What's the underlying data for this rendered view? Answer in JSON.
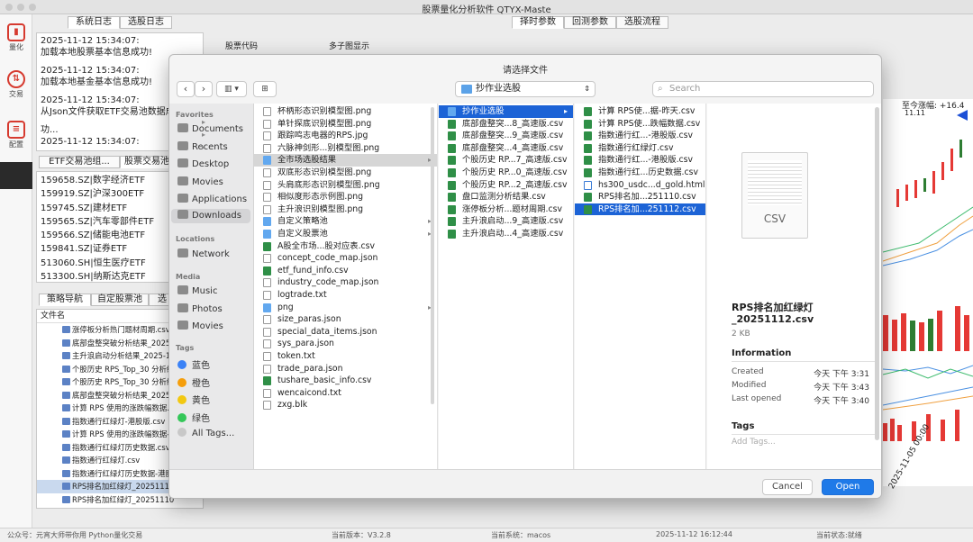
{
  "window": {
    "title": "股票量化分析软件 QTYX-Maste"
  },
  "toolbar": {
    "items": [
      {
        "label": "量化"
      },
      {
        "label": "交易"
      },
      {
        "label": "配置"
      }
    ]
  },
  "left_tabs": [
    "系统日志",
    "选股日志"
  ],
  "log": [
    "2025-11-12 15:34:07:",
    "加载本地股票基本信息成功!",
    "2025-11-12 15:34:07:",
    "加载本地基金基本信息成功!",
    "2025-11-12 15:34:07:",
    "从Json文件获取ETF交易池数据成",
    "功...",
    "2025-11-12 15:34:07:"
  ],
  "etf_tabs": [
    "ETF交易池组...",
    "股票交易池"
  ],
  "etf_list": [
    "159658.SZ|数字经济ETF",
    "159919.SZ|沪深300ETF",
    "159745.SZ|建材ETF",
    "159565.SZ|汽车零部件ETF",
    "159566.SZ|储能电池ETF",
    "159841.SZ|证券ETF",
    "513060.SH|恒生医疗ETF",
    "513300.SH|纳斯达克ETF"
  ],
  "nav_tabs": [
    "策略导航",
    "自定股票池",
    "选"
  ],
  "file_header": "文件名",
  "file_list": [
    "涨停板分析热门题材周期.csv",
    "底部盘整突破分析结果_2025",
    "主升浪启动分析结果_2025-1",
    "个股历史 RPS_Top_30 分析结",
    "个股历史 RPS_Top_30 分析结",
    "底部盘整突破分析结果_2025",
    "计算 RPS 使用的涨跌幅数据.c",
    "指数通行红绿灯-港股版.csv",
    "计算 RPS 使用的涨跌幅数据-",
    "指数通行红绿灯历史数据.csv",
    "指数通行红绿灯.csv",
    "指数通行红绿灯历史数据-港股",
    "RPS排名加红绿灯_2025111",
    "RPS排名加红绿灯_20251110"
  ],
  "right_tabs": [
    "择时参数",
    "回测参数",
    "选股流程"
  ],
  "right_labels": {
    "code": "股票代码",
    "multi": "多子图显示"
  },
  "chart_text": {
    "rise": "至今涨幅: +16.4",
    "price": "11.11",
    "xdate": "2025-11-05 00:00"
  },
  "dialog": {
    "title": "请选择文件",
    "path": "抄作业选股",
    "search_placeholder": "Search",
    "sidebar": {
      "favorites_header": "Favorites",
      "favorites": [
        "Documents",
        "Recents",
        "Desktop",
        "Movies",
        "Applications",
        "Downloads"
      ],
      "locations_header": "Locations",
      "locations": [
        "Network"
      ],
      "media_header": "Media",
      "media": [
        "Music",
        "Photos",
        "Movies"
      ],
      "tags_header": "Tags",
      "tags": [
        {
          "name": "蓝色",
          "color": "#3b82f6"
        },
        {
          "name": "橙色",
          "color": "#f59e0b"
        },
        {
          "name": "黄色",
          "color": "#f2c811"
        },
        {
          "name": "绿色",
          "color": "#34c759"
        },
        {
          "name": "All Tags...",
          "color": "#c8c8c8"
        }
      ]
    },
    "col1": [
      {
        "name": "杯柄形态识别模型图.png",
        "t": "d"
      },
      {
        "name": "单针探底识别模型图.png",
        "t": "d"
      },
      {
        "name": "跟踪鸣志电器的RPS.jpg",
        "t": "d"
      },
      {
        "name": "六脉神剑形...别模型图.png",
        "t": "d"
      },
      {
        "name": "全市场选股结果",
        "t": "f",
        "hl": true
      },
      {
        "name": "双底形态识别模型图.png",
        "t": "d"
      },
      {
        "name": "头肩底形态识别模型图.png",
        "t": "d"
      },
      {
        "name": "相似度形态示例图.png",
        "t": "d"
      },
      {
        "name": "主升浪识别模型图.png",
        "t": "d"
      },
      {
        "name": "自定义策略池",
        "t": "f"
      },
      {
        "name": "自定义股票池",
        "t": "f"
      },
      {
        "name": "A股全市场...股对应表.csv",
        "t": "x"
      },
      {
        "name": "concept_code_map.json",
        "t": "d"
      },
      {
        "name": "etf_fund_info.csv",
        "t": "x"
      },
      {
        "name": "industry_code_map.json",
        "t": "d"
      },
      {
        "name": "logtrade.txt",
        "t": "d"
      },
      {
        "name": "png",
        "t": "f"
      },
      {
        "name": "size_paras.json",
        "t": "d"
      },
      {
        "name": "special_data_items.json",
        "t": "d"
      },
      {
        "name": "sys_para.json",
        "t": "d"
      },
      {
        "name": "token.txt",
        "t": "d"
      },
      {
        "name": "trade_para.json",
        "t": "d"
      },
      {
        "name": "tushare_basic_info.csv",
        "t": "x"
      },
      {
        "name": "wencaicond.txt",
        "t": "d"
      },
      {
        "name": "zxg.blk",
        "t": "d"
      }
    ],
    "col1_arrows": [
      4,
      9,
      10,
      16
    ],
    "col2": [
      {
        "name": "抄作业选股",
        "t": "f",
        "sel": true
      },
      {
        "name": "底部盘整突...8_高速版.csv",
        "t": "x"
      },
      {
        "name": "底部盘整突...9_高速版.csv",
        "t": "x"
      },
      {
        "name": "底部盘整突...4_高速版.csv",
        "t": "x"
      },
      {
        "name": "个股历史 RP...7_高速版.csv",
        "t": "x"
      },
      {
        "name": "个股历史 RP...0_高速版.csv",
        "t": "x"
      },
      {
        "name": "个股历史 RP...2_高速版.csv",
        "t": "x"
      },
      {
        "name": "盘口监测分析结果.csv",
        "t": "x"
      },
      {
        "name": "涨停板分析...题材周期.csv",
        "t": "x"
      },
      {
        "name": "主升浪启动...9_高速版.csv",
        "t": "x"
      },
      {
        "name": "主升浪启动...4_高速版.csv",
        "t": "x"
      }
    ],
    "col3": [
      {
        "name": "计算 RPS使...据-昨天.csv",
        "t": "x"
      },
      {
        "name": "计算 RPS使...跌幅数据.csv",
        "t": "x"
      },
      {
        "name": "指数通行红...-港股版.csv",
        "t": "x"
      },
      {
        "name": "指数通行红绿灯.csv",
        "t": "x"
      },
      {
        "name": "指数通行红...-港股版.csv",
        "t": "x"
      },
      {
        "name": "指数通行红...历史数据.csv",
        "t": "x"
      },
      {
        "name": "hs300_usdc...d_gold.html",
        "t": "h"
      },
      {
        "name": "RPS排名加...251110.csv",
        "t": "x"
      },
      {
        "name": "RPS排名加...251112.csv",
        "t": "x",
        "sel": true
      }
    ],
    "preview": {
      "icon_label": "CSV",
      "filename1": "RPS排名加红绿灯",
      "filename2": "_20251112.csv",
      "size": "2 KB",
      "info_header": "Information",
      "created_label": "Created",
      "created_value": "今天 下午 3:31",
      "modified_label": "Modified",
      "modified_value": "今天 下午 3:43",
      "opened_label": "Last opened",
      "opened_value": "今天 下午 3:40",
      "tags_header": "Tags",
      "tags_placeholder": "Add Tags..."
    },
    "cancel_label": "Cancel",
    "open_label": "Open"
  },
  "status": {
    "left": "公众号：元宵大师带你用 Python量化交易",
    "version": "当前版本：V3.2.8",
    "system": "当前系统：macos",
    "time": "2025-11-12 16:12:44",
    "state": "当前状态:就绪"
  }
}
